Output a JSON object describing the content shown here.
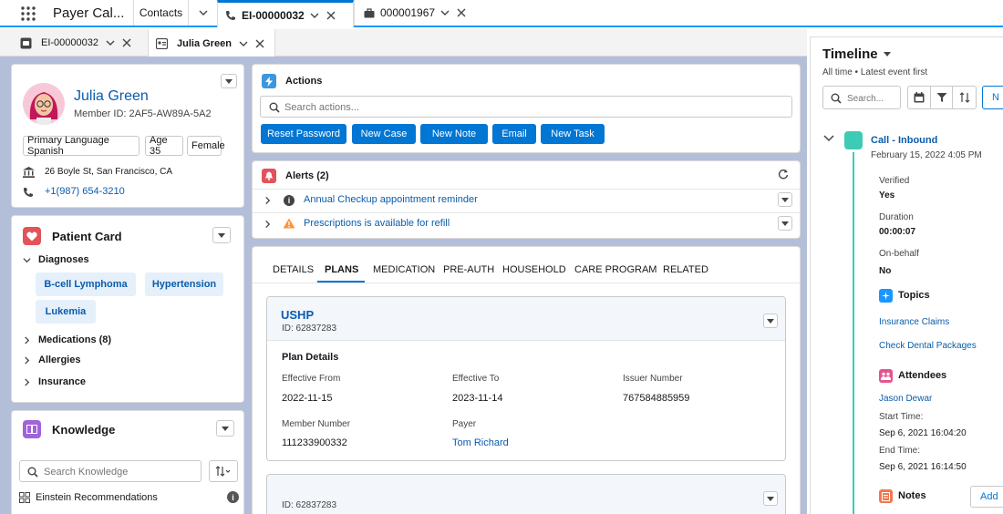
{
  "app": {
    "title": "Payer Cal..."
  },
  "top_tabs": [
    {
      "label": "Contacts"
    },
    {
      "label": "EI-00000032"
    },
    {
      "label": "000001967"
    }
  ],
  "sub_tabs": [
    {
      "label": "EI-00000032"
    },
    {
      "label": "Julia Green"
    }
  ],
  "member": {
    "name": "Julia Green",
    "member_id": "Member ID: 2AF5-AW89A-5A2",
    "language": "Primary Language Spanish",
    "age": "Age 35",
    "gender": "Female",
    "address": "26 Boyle St, San Francisco, CA",
    "phone": "+1(987) 654-3210"
  },
  "patient_card": {
    "title": "Patient Card",
    "diagnoses_label": "Diagnoses",
    "diagnoses": [
      "B-cell Lymphoma",
      "Hypertension",
      "Lukemia"
    ],
    "medications_label": "Medications (8)",
    "allergies_label": "Allergies",
    "insurance_label": "Insurance"
  },
  "knowledge": {
    "title": "Knowledge",
    "search_placeholder": "Search Knowledge",
    "recommendations_label": "Einstein Recommendations"
  },
  "actions": {
    "title": "Actions",
    "search_placeholder": "Search actions...",
    "buttons": [
      "Reset Password",
      "New Case",
      "New Note",
      "Email",
      "New Task"
    ]
  },
  "alerts": {
    "title": "Alerts (2)",
    "items": [
      {
        "label": "Annual Checkup appointment reminder"
      },
      {
        "label": "Prescriptions is available for refill"
      }
    ]
  },
  "detail_tabs": [
    "DETAILS",
    "PLANS",
    "MEDICATION",
    "PRE-AUTH",
    "HOUSEHOLD",
    "CARE PROGRAM",
    "RELATED"
  ],
  "plan": {
    "name": "USHP",
    "id": "ID: 62837283",
    "section_title": "Plan Details",
    "effective_from_label": "Effective From",
    "effective_from": "2022-11-15",
    "effective_to_label": "Effective To",
    "effective_to": "2023-11-14",
    "issuer_label": "Issuer Number",
    "issuer": "767584885959",
    "member_number_label": "Member Number",
    "member_number": "111233900332",
    "payer_label": "Payer",
    "payer": "Tom Richard"
  },
  "plan2": {
    "id": "ID: 62837283"
  },
  "timeline": {
    "title": "Timeline",
    "filter_text": "All time • Latest event first",
    "search_placeholder": "Search...",
    "new_btn": "N",
    "event_title": "Call - Inbound",
    "event_date": "February 15, 2022 4:05 PM",
    "verified_label": "Verified",
    "verified_value": "Yes",
    "duration_label": "Duration",
    "duration_value": "00:00:07",
    "onbehalf_label": "On-behalf",
    "onbehalf_value": "No",
    "topics_title": "Topics",
    "topics": [
      "Insurance Claims",
      "Check Dental Packages"
    ],
    "attendees_title": "Attendees",
    "attendee": "Jason Dewar",
    "start_label": "Start Time:",
    "start_value": "Sep 6, 2021 16:04:20",
    "end_label": "End Time:",
    "end_value": "Sep 6, 2021 16:14:50",
    "notes_title": "Notes",
    "add_btn": "Add"
  },
  "colors": {
    "brand_blue": "#0176d3",
    "link": "#0b5cab",
    "backdrop": "#b3bfd9",
    "timeline_teal": "#3ecbb5"
  }
}
